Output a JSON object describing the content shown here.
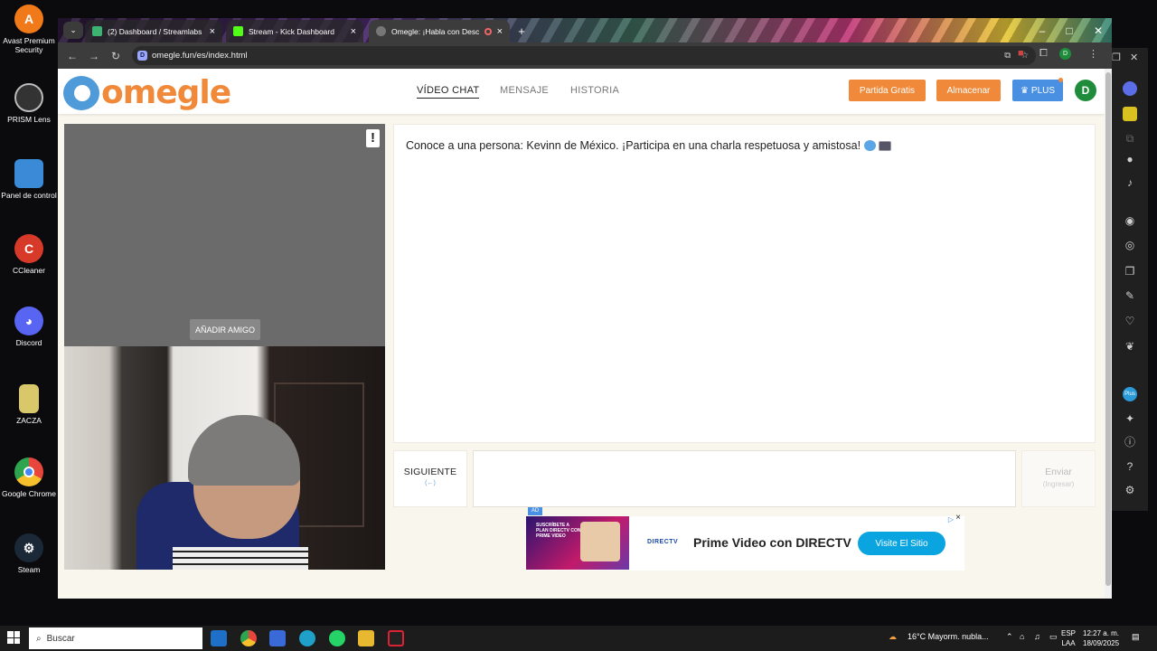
{
  "desktop": {
    "icons": [
      {
        "label": "Avast Premium Security",
        "color": "#f07a1a"
      },
      {
        "label": "PRISM Lens",
        "color": "#444444"
      },
      {
        "label": "Panel de control",
        "color": "#3a8ad8"
      },
      {
        "label": "CCleaner",
        "color": "#d83a2a"
      },
      {
        "label": "Discord",
        "color": "#5865f2"
      },
      {
        "label": "ZACZA",
        "color": "#d8c86a"
      },
      {
        "label": "Google Chrome",
        "color": "#e8453c"
      },
      {
        "label": "Steam",
        "color": "#1b2838"
      }
    ]
  },
  "browser": {
    "tabs": [
      {
        "label": "(2) Dashboard / Streamlabs",
        "close": "×"
      },
      {
        "label": "Stream - Kick Dashboard",
        "close": "×"
      },
      {
        "label": "Omegle: ¡Habla con Descon",
        "close": "×"
      }
    ],
    "new_tab": "+",
    "url": "omegle.fun/es/index.html",
    "profile_initial": "D"
  },
  "site": {
    "logo_text": "omegle",
    "nav": {
      "video_chat": "VÍDEO CHAT",
      "message": "MENSAJE",
      "history": "HISTORIA"
    },
    "buttons": {
      "free_game": "Partida Gratis",
      "store": "Almacenar",
      "plus": "PLUS"
    },
    "avatar_initial": "D",
    "report_glyph": "!",
    "add_friend": "AÑADIR AMIGO",
    "chat_message": "Conoce a una persona: Kevinn de México. ¡Participa en una charla respetuosa y amistosa!",
    "next": {
      "label": "SIGUIENTE",
      "hint": "(←)"
    },
    "send": {
      "label": "Enviar",
      "hint": "(Ingresar)"
    },
    "message_placeholder": ""
  },
  "ad": {
    "tag": "AD",
    "image_text": "SUSCRÍBETE A PLAN DIRECTV CON PRIME VIDEO",
    "brand": "DIRECTV",
    "title": "Prime Video con DIRECTV",
    "cta": "Visite El Sitio",
    "close": "×"
  },
  "taskbar": {
    "search_placeholder": "Buscar",
    "weather": "16°C  Mayorm. nubla...",
    "language_line1": "ESP",
    "language_line2": "LAA",
    "time": "12:27 a. m.",
    "date": "18/09/2025"
  }
}
